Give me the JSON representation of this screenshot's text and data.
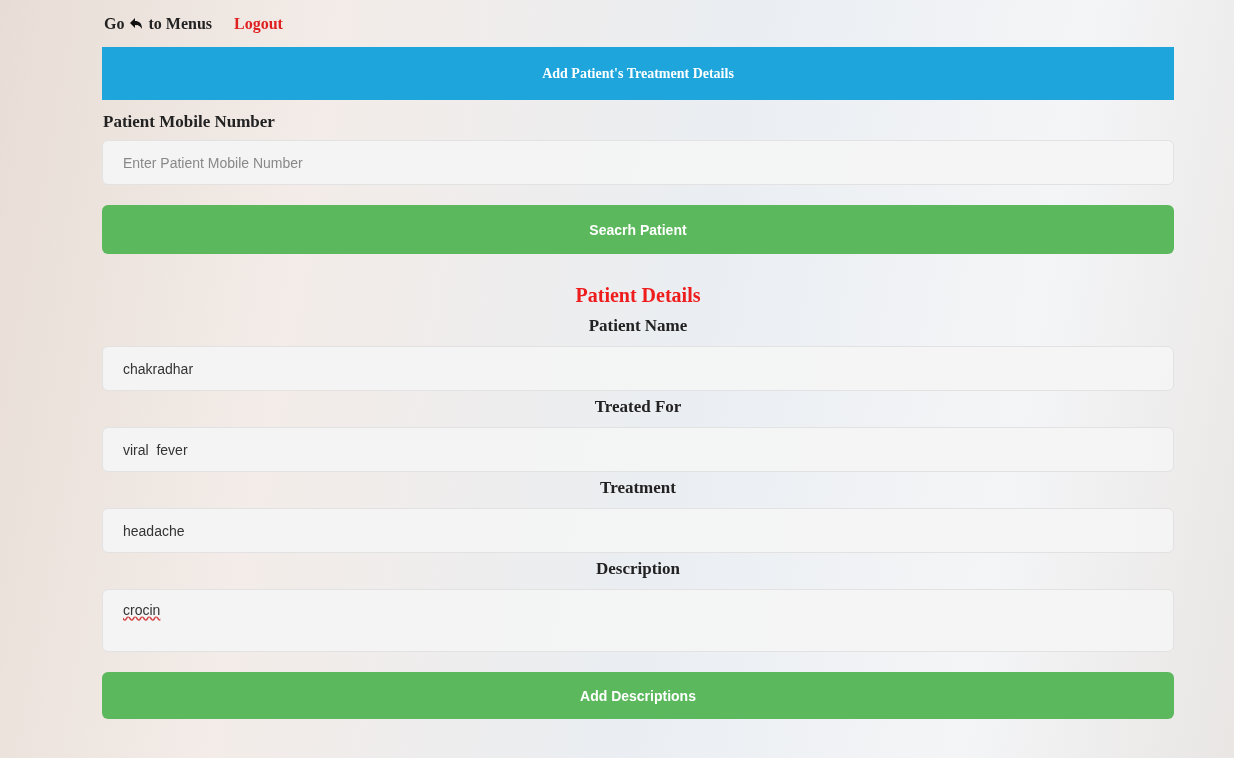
{
  "nav": {
    "back_link": {
      "before_icon": "Go",
      "after_icon": "to Menus"
    },
    "logout": "Logout"
  },
  "header": {
    "title": "Add Patient's Treatment Details"
  },
  "search": {
    "label": "Patient Mobile Number",
    "placeholder": "Enter Patient Mobile Number",
    "button": "Seacrh Patient"
  },
  "details": {
    "title": "Patient Details",
    "fields": [
      {
        "label": "Patient Name",
        "value": "chakradhar",
        "kind": "input"
      },
      {
        "label": "Treated For",
        "value": "viral  fever",
        "kind": "input"
      },
      {
        "label": "Treatment",
        "value": "headache",
        "kind": "input"
      },
      {
        "label": "Description",
        "value": "crocin",
        "kind": "textarea"
      }
    ],
    "button": "Add Descriptions"
  }
}
